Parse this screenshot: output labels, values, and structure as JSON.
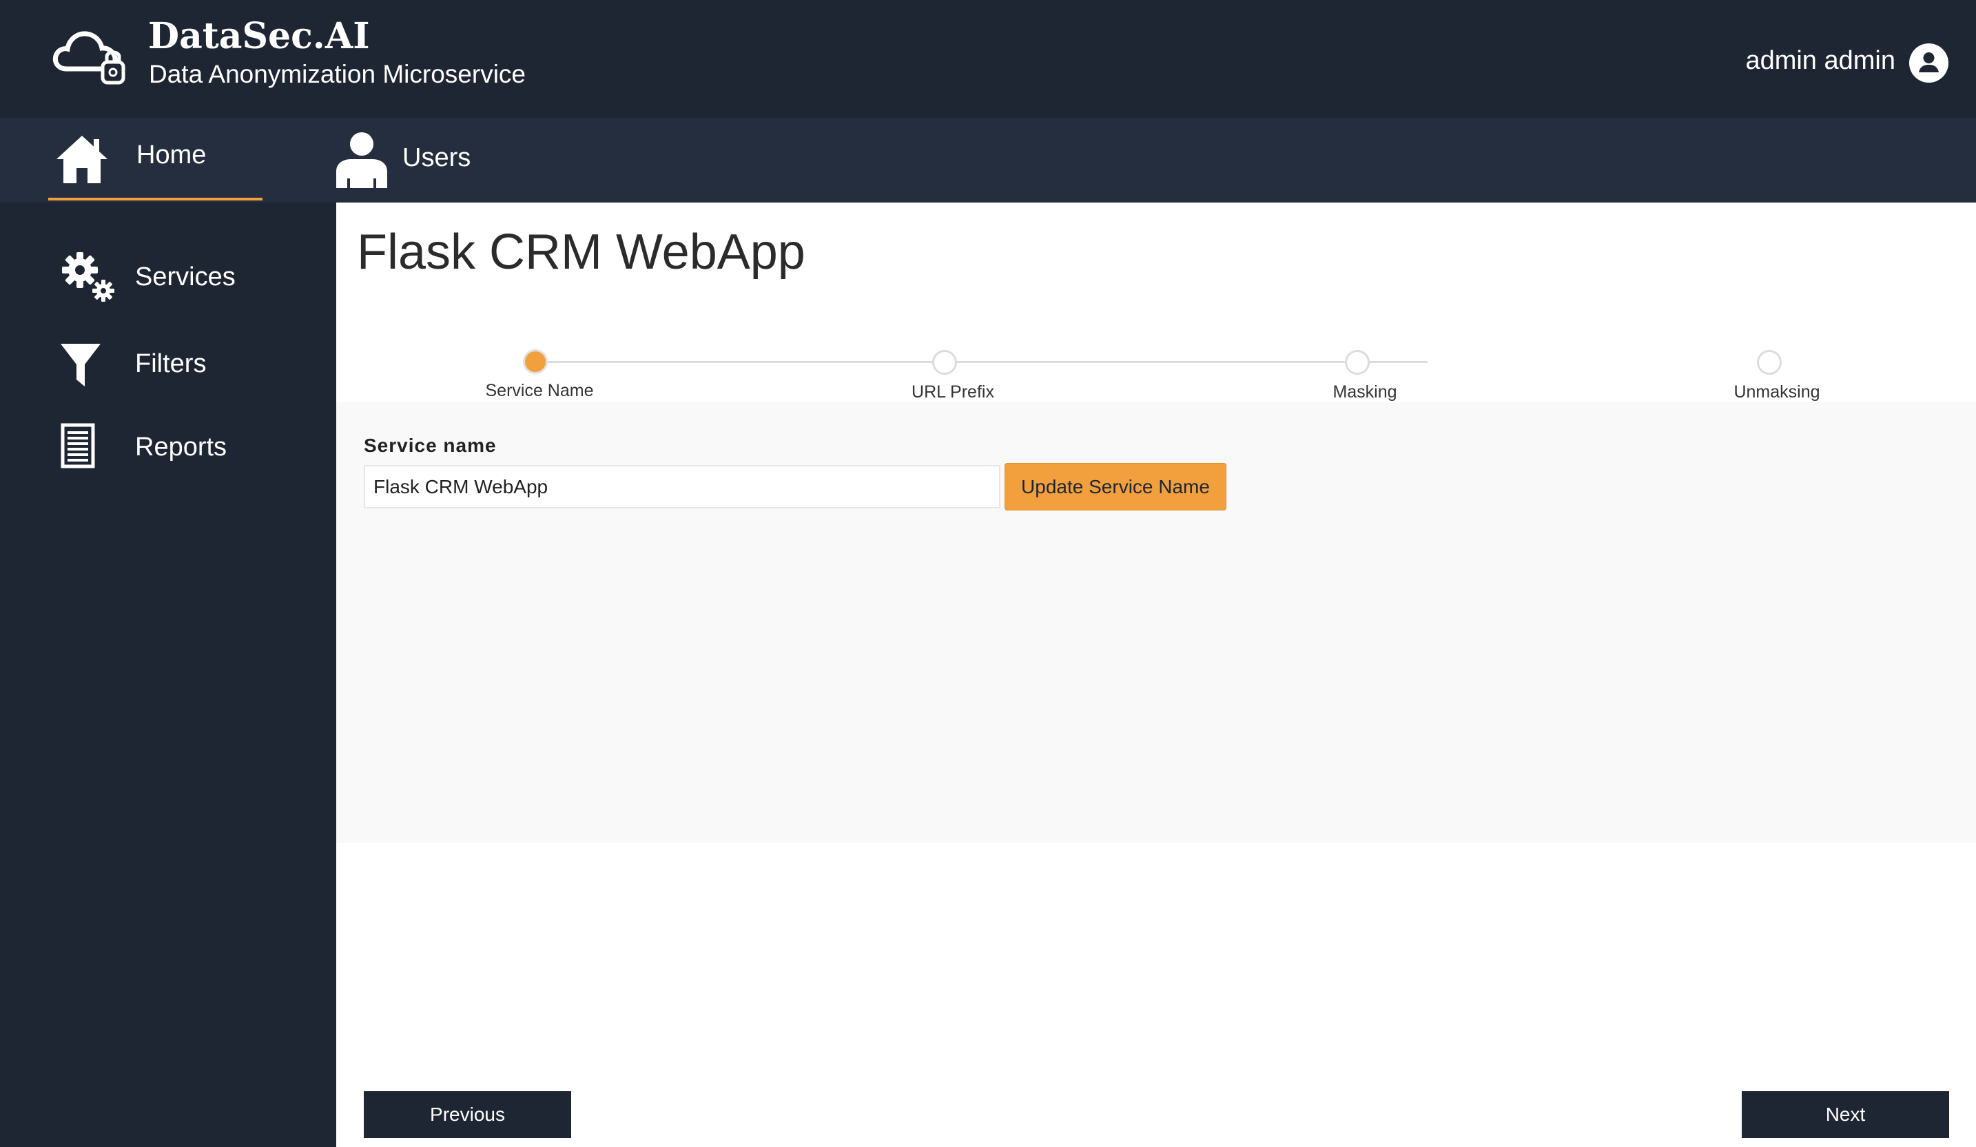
{
  "brand": {
    "title": "DataSec.AI",
    "subtitle": "Data Anonymization Microservice",
    "logo_icon": "cloud-lock-icon"
  },
  "user": {
    "name": "admin admin",
    "avatar_icon": "user-circle-icon"
  },
  "topnav": {
    "items": [
      {
        "label": "Home",
        "icon": "home-icon",
        "active": true
      },
      {
        "label": "Users",
        "icon": "user-icon",
        "active": false
      }
    ]
  },
  "sidebar": {
    "items": [
      {
        "label": "Services",
        "icon": "gears-icon"
      },
      {
        "label": "Filters",
        "icon": "filter-icon"
      },
      {
        "label": "Reports",
        "icon": "document-icon"
      }
    ]
  },
  "main": {
    "title": "Flask CRM WebApp",
    "stepper": {
      "steps": [
        {
          "label": "Service Name",
          "active": true
        },
        {
          "label": "URL Prefix",
          "active": false
        },
        {
          "label": "Masking",
          "active": false
        },
        {
          "label": "Unmaksing",
          "active": false
        }
      ]
    },
    "form": {
      "label": "Service name",
      "value": "Flask CRM WebApp",
      "update_button": "Update Service Name"
    },
    "footer": {
      "previous": "Previous",
      "next": "Next"
    }
  },
  "colors": {
    "header_bg": "#1f2633",
    "nav_bg": "#252e3f",
    "accent": "#f2a03d",
    "panel_bg": "#f9f9f9"
  }
}
